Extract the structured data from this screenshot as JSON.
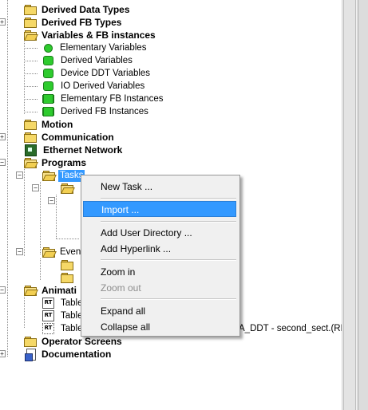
{
  "tree": {
    "derived_data_types": "Derived Data Types",
    "derived_fb_types": "Derived FB Types",
    "variables_fb": "Variables & FB instances",
    "elementary_variables": "Elementary Variables",
    "derived_variables": "Derived Variables",
    "device_ddt_variables": "Device DDT Variables",
    "io_derived_variables": "IO Derived Variables",
    "elementary_fb_instances": "Elementary FB Instances",
    "derived_fb_instances": "Derived FB Instances",
    "motion": "Motion",
    "communication": "Communication",
    "ethernet_network": "Ethernet Network",
    "programs": "Programs",
    "tasks": "Tasks",
    "events_partial": "Even",
    "animation_partial": "Animati",
    "table1": "Table",
    "table2": "Table",
    "table3": "Table",
    "table3_trailing": "A_DDT - second_sect.(REA",
    "operator_screens": "Operator Screens",
    "documentation": "Documentation",
    "rt_badge": "RT"
  },
  "context_menu": {
    "new_task": "New Task ...",
    "import": "Import ...",
    "add_user_directory": "Add User Directory ...",
    "add_hyperlink": "Add Hyperlink ...",
    "zoom_in": "Zoom in",
    "zoom_out": "Zoom out",
    "expand_all": "Expand all",
    "collapse_all": "Collapse all"
  },
  "colors": {
    "selection": "#3399ff",
    "menu_bg": "#f0f0f0",
    "folder": "#f5d867",
    "variable_icon": "#2ecb2e"
  }
}
